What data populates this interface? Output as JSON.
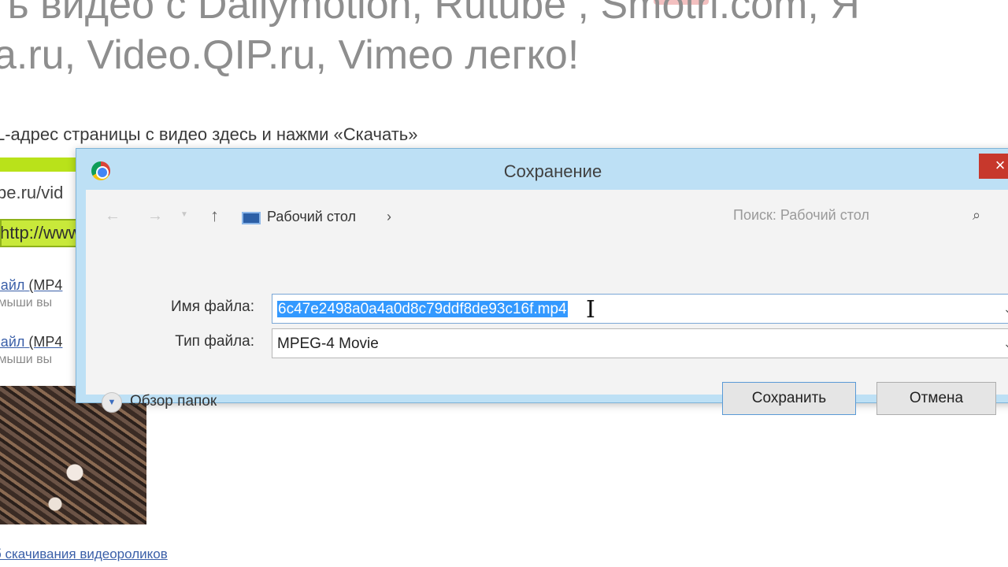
{
  "background_page": {
    "heading_line1": "ать видео с Dailymotion, Rutube , Smotri.com, Я",
    "heading_line2": "a.ru, Video.QIP.ru, Vimeo легко!",
    "instruction": "L-адрес страницы с видео здесь и нажми «Скачать»",
    "url_line1": "be.ru/vid",
    "url_line2": "http://www",
    "link1": "файл",
    "link1_suffix": "(MP4",
    "hint1": "к мыши вы",
    "link2": "файл",
    "link2_suffix": "(MP4",
    "hint2": "к мыши вы",
    "footer_link": "б скачивания видеороликов"
  },
  "dialog": {
    "title": "Сохранение",
    "close_label": "×",
    "nav": {
      "back_label": "←",
      "forward_label": "→",
      "up_label": "↑",
      "path_label": "Рабочий стол",
      "path_separator": "›",
      "path_dropdown": "⌄",
      "refresh_label": "↻",
      "search_placeholder": "Поиск: Рабочий стол",
      "search_icon": "⌕"
    },
    "filename_label": "Имя файла:",
    "filename_value": "6c47e2498a0a4a0d8c79ddf8de93c16f.mp4",
    "filetype_label": "Тип файла:",
    "filetype_value": "MPEG-4 Movie",
    "browse_folders_label": "Обзор папок",
    "save_label": "Сохранить",
    "cancel_label": "Отмена"
  },
  "colors": {
    "dialog_frame": "#bde0f5",
    "selection": "#3399ff",
    "close_button": "#c7382c",
    "highlight_green": "#b9e21a"
  }
}
